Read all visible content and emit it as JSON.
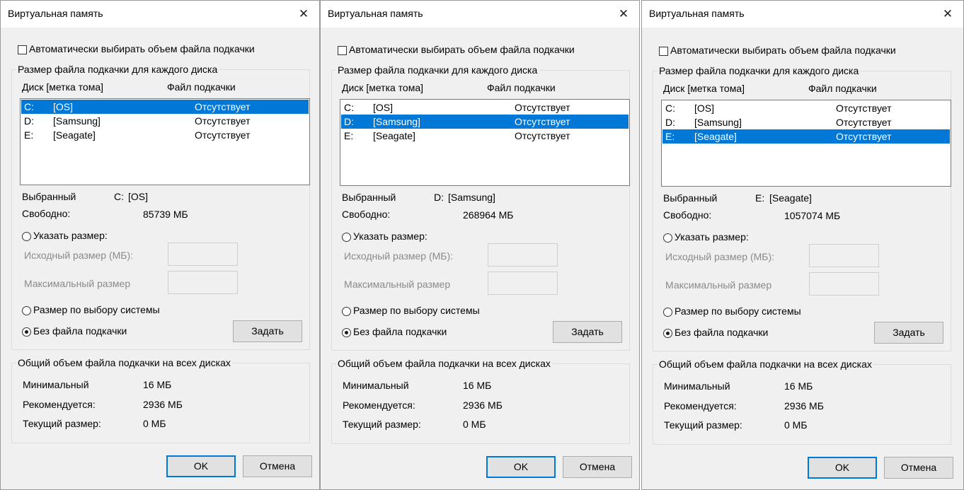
{
  "dialog": {
    "title": "Виртуальная память",
    "close_glyph": "✕",
    "auto_checkbox_label": "Автоматически выбирать объем файла подкачки",
    "per_disk_group_title": "Размер файла подкачки для каждого диска",
    "col_disk": "Диск [метка тома]",
    "col_pagefile": "Файл подкачки",
    "drives": [
      {
        "letter": "C:",
        "label": "[OS]",
        "pagefile": "Отсутствует"
      },
      {
        "letter": "D:",
        "label": "[Samsung]",
        "pagefile": "Отсутствует"
      },
      {
        "letter": "E:",
        "label": "[Seagate]",
        "pagefile": "Отсутствует"
      }
    ],
    "selected_caption": "Выбранный",
    "free_caption": "Свободно:",
    "custom_size_label": "Указать размер:",
    "initial_size_label": "Исходный размер (МБ):",
    "max_size_label": "Максимальный размер",
    "system_managed_label": "Размер по выбору системы",
    "no_pagefile_label": "Без файла подкачки",
    "set_button": "Задать",
    "total_group_title": "Общий объем файла подкачки на всех дисках",
    "min_caption": "Минимальный",
    "min_value": "16 МБ",
    "recommended_caption": "Рекомендуется:",
    "recommended_value": "2936 МБ",
    "current_caption": "Текущий размер:",
    "current_value": "0 МБ",
    "ok_button": "OK",
    "cancel_button": "Отмена"
  },
  "panels": [
    {
      "selected_drive": "C:",
      "selected_label": "[OS]",
      "free": "85739 МБ",
      "selected_index": 0
    },
    {
      "selected_drive": "D:",
      "selected_label": "[Samsung]",
      "free": "268964 МБ",
      "selected_index": 1
    },
    {
      "selected_drive": "E:",
      "selected_label": "[Seagate]",
      "free": "1057074 МБ",
      "selected_index": 2
    }
  ],
  "colors": {
    "selection": "#0078d7",
    "dialog_bg": "#f0f0f0"
  }
}
